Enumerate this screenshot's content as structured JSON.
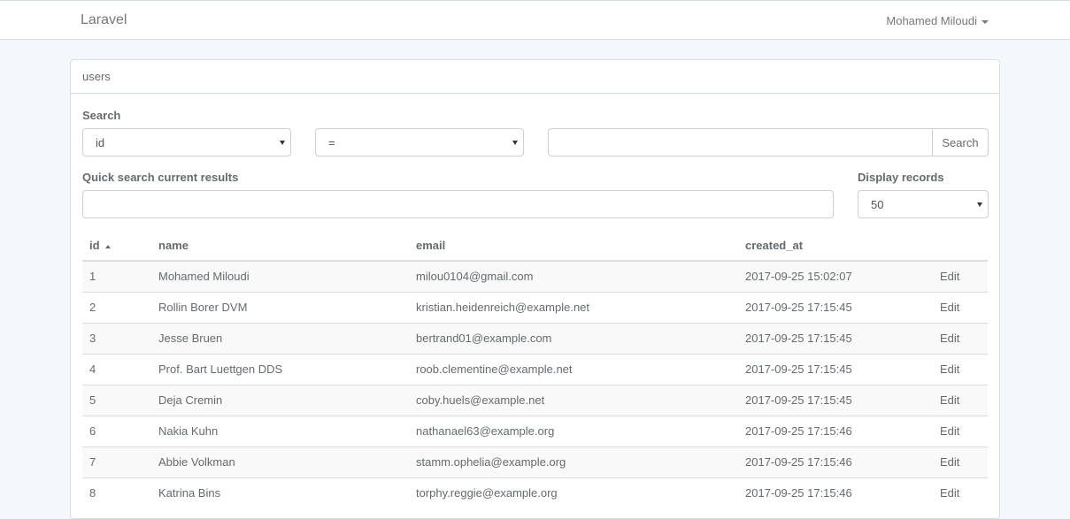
{
  "navbar": {
    "brand": "Laravel",
    "user_name": "Mohamed Miloudi"
  },
  "panel": {
    "heading": "users"
  },
  "search": {
    "label": "Search",
    "field_select": "id",
    "operator_select": "=",
    "value": "",
    "button_label": "Search"
  },
  "quick_search": {
    "label": "Quick search current results",
    "value": ""
  },
  "display_records": {
    "label": "Display records",
    "value": "50"
  },
  "table": {
    "columns": [
      "id",
      "name",
      "email",
      "created_at"
    ],
    "sort_column": "id",
    "sort_direction": "asc",
    "rows": [
      {
        "id": "1",
        "name": "Mohamed Miloudi",
        "email": "milou0104@gmail.com",
        "created_at": "2017-09-25 15:02:07",
        "action": "Edit"
      },
      {
        "id": "2",
        "name": "Rollin Borer DVM",
        "email": "kristian.heidenreich@example.net",
        "created_at": "2017-09-25 17:15:45",
        "action": "Edit"
      },
      {
        "id": "3",
        "name": "Jesse Bruen",
        "email": "bertrand01@example.com",
        "created_at": "2017-09-25 17:15:45",
        "action": "Edit"
      },
      {
        "id": "4",
        "name": "Prof. Bart Luettgen DDS",
        "email": "roob.clementine@example.net",
        "created_at": "2017-09-25 17:15:45",
        "action": "Edit"
      },
      {
        "id": "5",
        "name": "Deja Cremin",
        "email": "coby.huels@example.net",
        "created_at": "2017-09-25 17:15:45",
        "action": "Edit"
      },
      {
        "id": "6",
        "name": "Nakia Kuhn",
        "email": "nathanael63@example.org",
        "created_at": "2017-09-25 17:15:46",
        "action": "Edit"
      },
      {
        "id": "7",
        "name": "Abbie Volkman",
        "email": "stamm.ophelia@example.org",
        "created_at": "2017-09-25 17:15:46",
        "action": "Edit"
      },
      {
        "id": "8",
        "name": "Katrina Bins",
        "email": "torphy.reggie@example.org",
        "created_at": "2017-09-25 17:15:46",
        "action": "Edit"
      }
    ]
  },
  "colors": {
    "link": "#3097d1",
    "background": "#f5f8fa",
    "border": "#d3e0e9"
  }
}
